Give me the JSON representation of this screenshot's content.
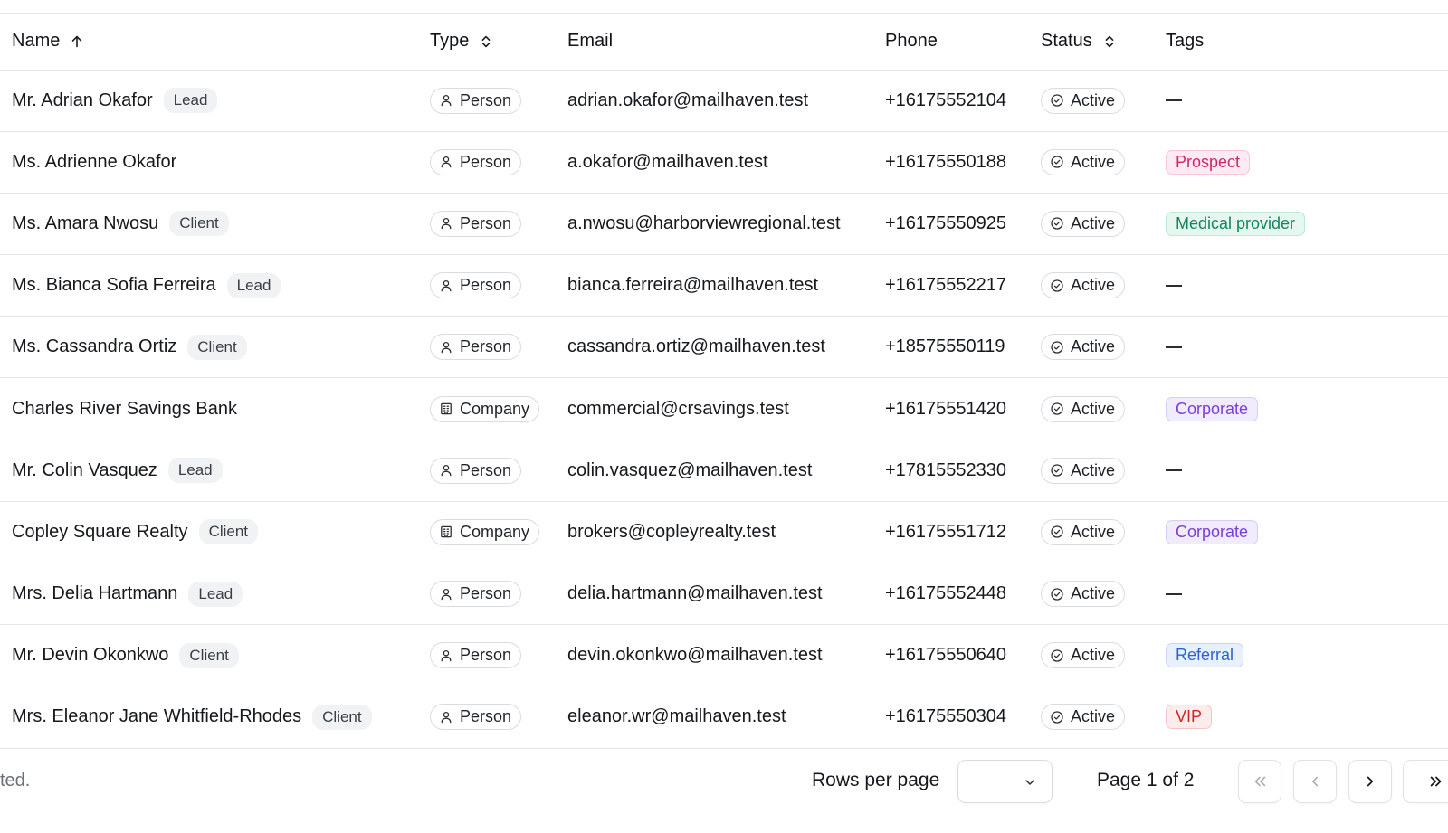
{
  "table": {
    "headers": {
      "name": "Name",
      "type": "Type",
      "email": "Email",
      "phone": "Phone",
      "status": "Status",
      "tags": "Tags"
    },
    "rows": [
      {
        "name": "Mr. Adrian Okafor",
        "role": "Lead",
        "type": "Person",
        "type_icon": "user-icon",
        "email": "adrian.okafor@mailhaven.test",
        "phone": "+16175552104",
        "status": "Active",
        "tag": "",
        "tag_style": ""
      },
      {
        "name": "Ms. Adrienne Okafor",
        "role": "",
        "type": "Person",
        "type_icon": "user-icon",
        "email": "a.okafor@mailhaven.test",
        "phone": "+16175550188",
        "status": "Active",
        "tag": "Prospect",
        "tag_style": "prospect"
      },
      {
        "name": "Ms. Amara Nwosu",
        "role": "Client",
        "type": "Person",
        "type_icon": "user-icon",
        "email": "a.nwosu@harborviewregional.test",
        "phone": "+16175550925",
        "status": "Active",
        "tag": "Medical provider",
        "tag_style": "medical"
      },
      {
        "name": "Ms. Bianca Sofia Ferreira",
        "role": "Lead",
        "type": "Person",
        "type_icon": "user-icon",
        "email": "bianca.ferreira@mailhaven.test",
        "phone": "+16175552217",
        "status": "Active",
        "tag": "",
        "tag_style": ""
      },
      {
        "name": "Ms. Cassandra Ortiz",
        "role": "Client",
        "type": "Person",
        "type_icon": "user-icon",
        "email": "cassandra.ortiz@mailhaven.test",
        "phone": "+18575550119",
        "status": "Active",
        "tag": "",
        "tag_style": ""
      },
      {
        "name": "Charles River Savings Bank",
        "role": "",
        "type": "Company",
        "type_icon": "building-icon",
        "email": "commercial@crsavings.test",
        "phone": "+16175551420",
        "status": "Active",
        "tag": "Corporate",
        "tag_style": "corporate"
      },
      {
        "name": "Mr. Colin Vasquez",
        "role": "Lead",
        "type": "Person",
        "type_icon": "user-icon",
        "email": "colin.vasquez@mailhaven.test",
        "phone": "+17815552330",
        "status": "Active",
        "tag": "",
        "tag_style": ""
      },
      {
        "name": "Copley Square Realty",
        "role": "Client",
        "type": "Company",
        "type_icon": "building-icon",
        "email": "brokers@copleyrealty.test",
        "phone": "+16175551712",
        "status": "Active",
        "tag": "Corporate",
        "tag_style": "corporate"
      },
      {
        "name": "Mrs. Delia Hartmann",
        "role": "Lead",
        "type": "Person",
        "type_icon": "user-icon",
        "email": "delia.hartmann@mailhaven.test",
        "phone": "+16175552448",
        "status": "Active",
        "tag": "",
        "tag_style": ""
      },
      {
        "name": "Mr. Devin Okonkwo",
        "role": "Client",
        "type": "Person",
        "type_icon": "user-icon",
        "email": "devin.okonkwo@mailhaven.test",
        "phone": "+16175550640",
        "status": "Active",
        "tag": "Referral",
        "tag_style": "referral"
      },
      {
        "name": "Mrs. Eleanor Jane Whitfield-Rhodes",
        "role": "Client",
        "type": "Person",
        "type_icon": "user-icon",
        "email": "eleanor.wr@mailhaven.test",
        "phone": "+16175550304",
        "status": "Active",
        "tag": "VIP",
        "tag_style": "vip"
      }
    ]
  },
  "footer": {
    "selection_text": "ted.",
    "rows_per_page_label": "Rows per page",
    "rows_per_page_value": "",
    "page_info": "Page 1 of 2"
  },
  "colors": {
    "border": "#e4e6ea",
    "prospect": "#d02768",
    "medical": "#14865a",
    "corporate": "#7b3fd8",
    "referral": "#2d62d6",
    "vip": "#d02626"
  }
}
